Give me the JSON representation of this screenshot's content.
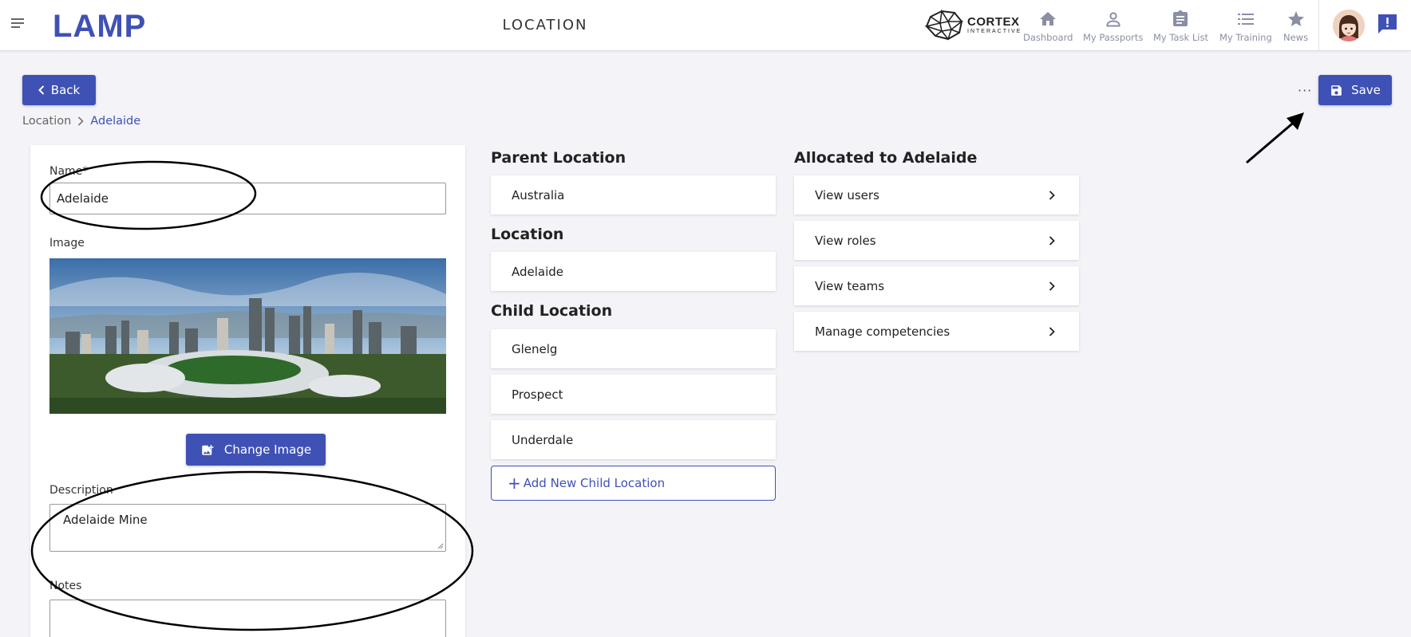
{
  "header": {
    "title": "LOCATION",
    "logo_text": "LAMP",
    "partner_logo": {
      "main": "CORTEX",
      "sub": "INTERACTIVE"
    },
    "nav": [
      {
        "label": "Dashboard",
        "icon": "home-icon"
      },
      {
        "label": "My Passports",
        "icon": "person-icon"
      },
      {
        "label": "My Task List",
        "icon": "clipboard-icon"
      },
      {
        "label": "My Training",
        "icon": "list-icon"
      },
      {
        "label": "News",
        "icon": "star-icon"
      }
    ]
  },
  "toolbar": {
    "back_label": "Back",
    "save_label": "Save",
    "more_label": "···"
  },
  "breadcrumb": {
    "root": "Location",
    "current": "Adelaide"
  },
  "form": {
    "name_label": "Name*",
    "name_value": "Adelaide",
    "image_label": "Image",
    "change_image_label": "Change Image",
    "description_label": "Description",
    "description_value": "Adelaide Mine",
    "notes_label": "Notes",
    "notes_value": ""
  },
  "locations": {
    "parent_title": "Parent Location",
    "parent": "Australia",
    "location_title": "Location",
    "location": "Adelaide",
    "child_title": "Child Location",
    "children": [
      "Glenelg",
      "Prospect",
      "Underdale"
    ],
    "add_child_label": "Add New Child Location"
  },
  "allocated": {
    "title": "Allocated to Adelaide",
    "links": [
      "View users",
      "View roles",
      "View teams",
      "Manage competencies"
    ]
  },
  "colors": {
    "brand": "#3f51b5",
    "nav_icon": "#8a8fa3",
    "background": "#f3f3f8"
  }
}
